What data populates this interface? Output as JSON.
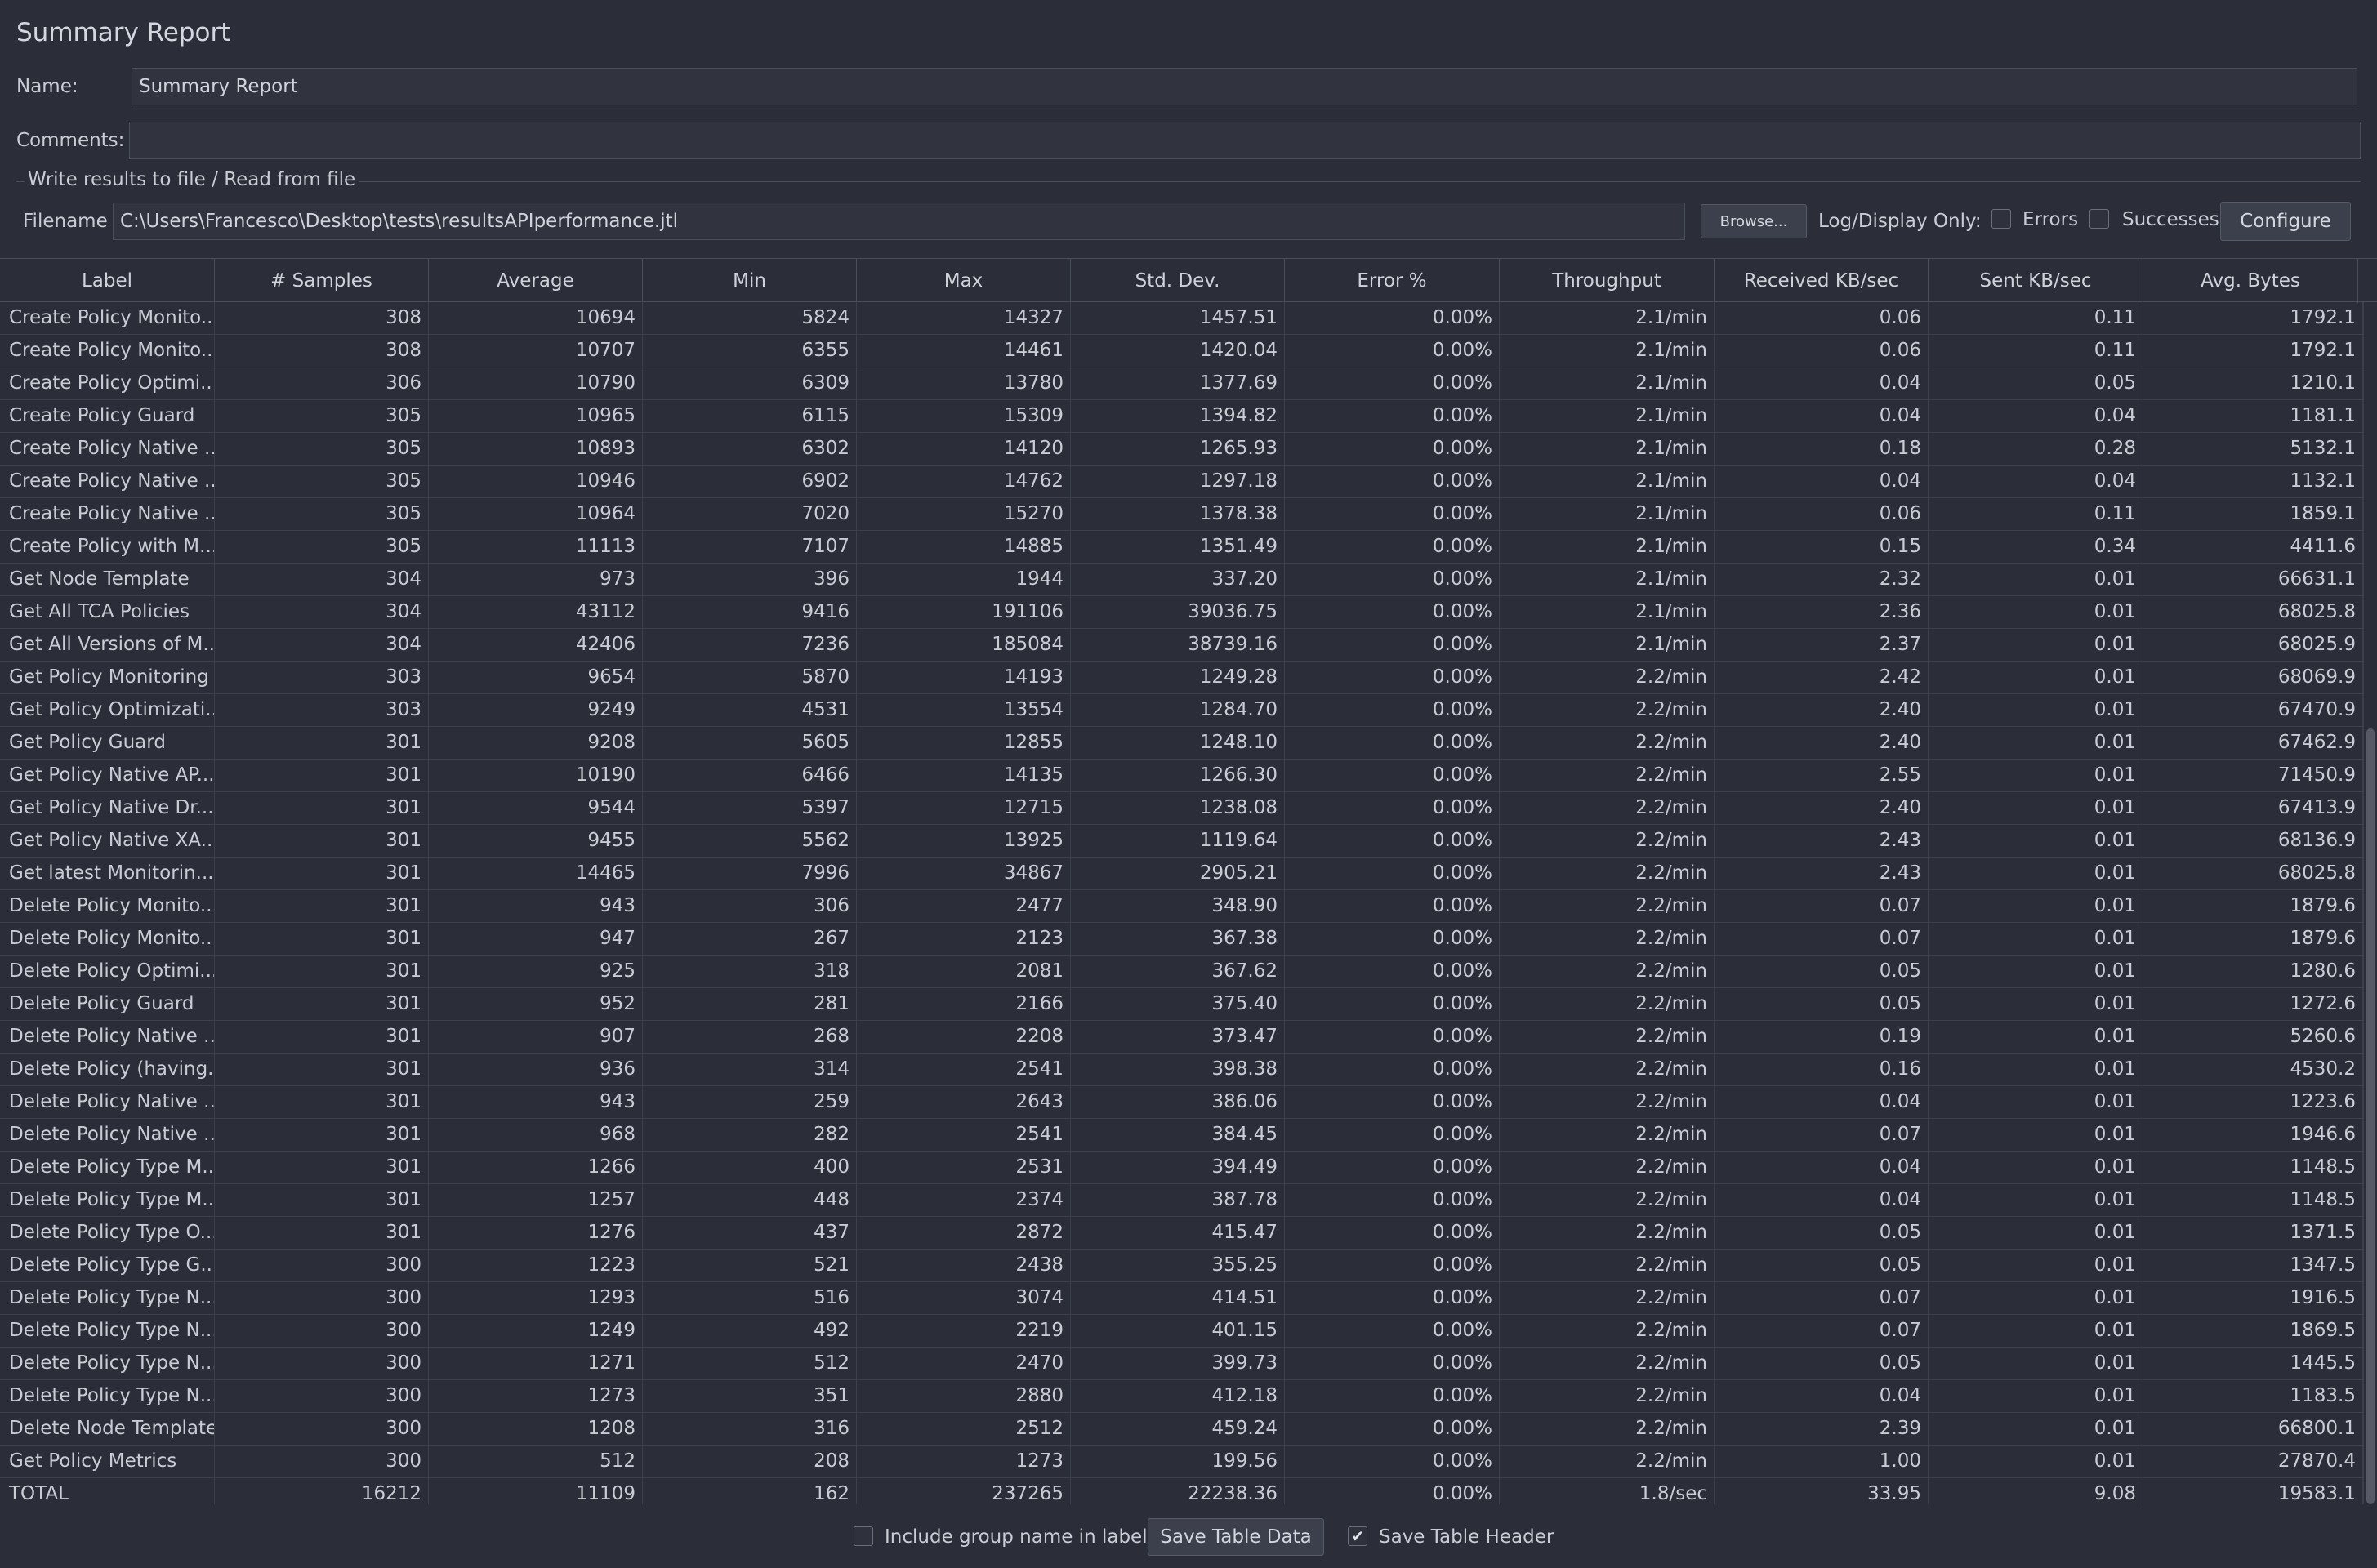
{
  "panel": {
    "title": "Summary Report"
  },
  "name": {
    "label": "Name:",
    "value": "Summary Report"
  },
  "comments": {
    "label": "Comments:",
    "value": ""
  },
  "file_group": {
    "title": "Write results to file / Read from file",
    "filename_label": "Filename",
    "filename_value": "C:\\Users\\Francesco\\Desktop\\tests\\resultsAPIperformance.jtl",
    "browse_label": "Browse...",
    "log_display_label": "Log/Display Only:",
    "errors_label": "Errors",
    "errors_checked": false,
    "successes_label": "Successes",
    "successes_checked": false,
    "configure_label": "Configure"
  },
  "table": {
    "columns": [
      "Label",
      "# Samples",
      "Average",
      "Min",
      "Max",
      "Std. Dev.",
      "Error %",
      "Throughput",
      "Received KB/sec",
      "Sent KB/sec",
      "Avg. Bytes"
    ],
    "rows": [
      [
        "Create Policy Monito...",
        "308",
        "10694",
        "5824",
        "14327",
        "1457.51",
        "0.00%",
        "2.1/min",
        "0.06",
        "0.11",
        "1792.1"
      ],
      [
        "Create Policy Monito...",
        "308",
        "10707",
        "6355",
        "14461",
        "1420.04",
        "0.00%",
        "2.1/min",
        "0.06",
        "0.11",
        "1792.1"
      ],
      [
        "Create Policy Optimi...",
        "306",
        "10790",
        "6309",
        "13780",
        "1377.69",
        "0.00%",
        "2.1/min",
        "0.04",
        "0.05",
        "1210.1"
      ],
      [
        "Create Policy Guard",
        "305",
        "10965",
        "6115",
        "15309",
        "1394.82",
        "0.00%",
        "2.1/min",
        "0.04",
        "0.04",
        "1181.1"
      ],
      [
        "Create Policy Native ...",
        "305",
        "10893",
        "6302",
        "14120",
        "1265.93",
        "0.00%",
        "2.1/min",
        "0.18",
        "0.28",
        "5132.1"
      ],
      [
        "Create Policy Native ...",
        "305",
        "10946",
        "6902",
        "14762",
        "1297.18",
        "0.00%",
        "2.1/min",
        "0.04",
        "0.04",
        "1132.1"
      ],
      [
        "Create Policy Native ...",
        "305",
        "10964",
        "7020",
        "15270",
        "1378.38",
        "0.00%",
        "2.1/min",
        "0.06",
        "0.11",
        "1859.1"
      ],
      [
        "Create Policy with M...",
        "305",
        "11113",
        "7107",
        "14885",
        "1351.49",
        "0.00%",
        "2.1/min",
        "0.15",
        "0.34",
        "4411.6"
      ],
      [
        "Get Node Template",
        "304",
        "973",
        "396",
        "1944",
        "337.20",
        "0.00%",
        "2.1/min",
        "2.32",
        "0.01",
        "66631.1"
      ],
      [
        "Get All TCA Policies",
        "304",
        "43112",
        "9416",
        "191106",
        "39036.75",
        "0.00%",
        "2.1/min",
        "2.36",
        "0.01",
        "68025.8"
      ],
      [
        "Get All Versions of M...",
        "304",
        "42406",
        "7236",
        "185084",
        "38739.16",
        "0.00%",
        "2.1/min",
        "2.37",
        "0.01",
        "68025.9"
      ],
      [
        "Get Policy Monitoring",
        "303",
        "9654",
        "5870",
        "14193",
        "1249.28",
        "0.00%",
        "2.2/min",
        "2.42",
        "0.01",
        "68069.9"
      ],
      [
        "Get Policy Optimizati...",
        "303",
        "9249",
        "4531",
        "13554",
        "1284.70",
        "0.00%",
        "2.2/min",
        "2.40",
        "0.01",
        "67470.9"
      ],
      [
        "Get Policy Guard",
        "301",
        "9208",
        "5605",
        "12855",
        "1248.10",
        "0.00%",
        "2.2/min",
        "2.40",
        "0.01",
        "67462.9"
      ],
      [
        "Get Policy Native AP...",
        "301",
        "10190",
        "6466",
        "14135",
        "1266.30",
        "0.00%",
        "2.2/min",
        "2.55",
        "0.01",
        "71450.9"
      ],
      [
        "Get Policy Native Dr...",
        "301",
        "9544",
        "5397",
        "12715",
        "1238.08",
        "0.00%",
        "2.2/min",
        "2.40",
        "0.01",
        "67413.9"
      ],
      [
        "Get Policy Native XA...",
        "301",
        "9455",
        "5562",
        "13925",
        "1119.64",
        "0.00%",
        "2.2/min",
        "2.43",
        "0.01",
        "68136.9"
      ],
      [
        "Get latest Monitorin...",
        "301",
        "14465",
        "7996",
        "34867",
        "2905.21",
        "0.00%",
        "2.2/min",
        "2.43",
        "0.01",
        "68025.8"
      ],
      [
        "Delete Policy Monito...",
        "301",
        "943",
        "306",
        "2477",
        "348.90",
        "0.00%",
        "2.2/min",
        "0.07",
        "0.01",
        "1879.6"
      ],
      [
        "Delete Policy Monito...",
        "301",
        "947",
        "267",
        "2123",
        "367.38",
        "0.00%",
        "2.2/min",
        "0.07",
        "0.01",
        "1879.6"
      ],
      [
        "Delete Policy Optimi...",
        "301",
        "925",
        "318",
        "2081",
        "367.62",
        "0.00%",
        "2.2/min",
        "0.05",
        "0.01",
        "1280.6"
      ],
      [
        "Delete Policy Guard",
        "301",
        "952",
        "281",
        "2166",
        "375.40",
        "0.00%",
        "2.2/min",
        "0.05",
        "0.01",
        "1272.6"
      ],
      [
        "Delete Policy Native ...",
        "301",
        "907",
        "268",
        "2208",
        "373.47",
        "0.00%",
        "2.2/min",
        "0.19",
        "0.01",
        "5260.6"
      ],
      [
        "Delete Policy (having...",
        "301",
        "936",
        "314",
        "2541",
        "398.38",
        "0.00%",
        "2.2/min",
        "0.16",
        "0.01",
        "4530.2"
      ],
      [
        "Delete Policy Native ...",
        "301",
        "943",
        "259",
        "2643",
        "386.06",
        "0.00%",
        "2.2/min",
        "0.04",
        "0.01",
        "1223.6"
      ],
      [
        "Delete Policy Native ...",
        "301",
        "968",
        "282",
        "2541",
        "384.45",
        "0.00%",
        "2.2/min",
        "0.07",
        "0.01",
        "1946.6"
      ],
      [
        "Delete Policy Type M...",
        "301",
        "1266",
        "400",
        "2531",
        "394.49",
        "0.00%",
        "2.2/min",
        "0.04",
        "0.01",
        "1148.5"
      ],
      [
        "Delete Policy Type M...",
        "301",
        "1257",
        "448",
        "2374",
        "387.78",
        "0.00%",
        "2.2/min",
        "0.04",
        "0.01",
        "1148.5"
      ],
      [
        "Delete Policy Type O...",
        "301",
        "1276",
        "437",
        "2872",
        "415.47",
        "0.00%",
        "2.2/min",
        "0.05",
        "0.01",
        "1371.5"
      ],
      [
        "Delete Policy Type G...",
        "300",
        "1223",
        "521",
        "2438",
        "355.25",
        "0.00%",
        "2.2/min",
        "0.05",
        "0.01",
        "1347.5"
      ],
      [
        "Delete Policy Type N...",
        "300",
        "1293",
        "516",
        "3074",
        "414.51",
        "0.00%",
        "2.2/min",
        "0.07",
        "0.01",
        "1916.5"
      ],
      [
        "Delete Policy Type N...",
        "300",
        "1249",
        "492",
        "2219",
        "401.15",
        "0.00%",
        "2.2/min",
        "0.07",
        "0.01",
        "1869.5"
      ],
      [
        "Delete Policy Type N...",
        "300",
        "1271",
        "512",
        "2470",
        "399.73",
        "0.00%",
        "2.2/min",
        "0.05",
        "0.01",
        "1445.5"
      ],
      [
        "Delete Policy Type N...",
        "300",
        "1273",
        "351",
        "2880",
        "412.18",
        "0.00%",
        "2.2/min",
        "0.04",
        "0.01",
        "1183.5"
      ],
      [
        "Delete Node Template",
        "300",
        "1208",
        "316",
        "2512",
        "459.24",
        "0.00%",
        "2.2/min",
        "2.39",
        "0.01",
        "66800.1"
      ],
      [
        "Get Policy Metrics",
        "300",
        "512",
        "208",
        "1273",
        "199.56",
        "0.00%",
        "2.2/min",
        "1.00",
        "0.01",
        "27870.4"
      ],
      [
        "TOTAL",
        "16212",
        "11109",
        "162",
        "237265",
        "22238.36",
        "0.00%",
        "1.8/sec",
        "33.95",
        "9.08",
        "19583.1"
      ]
    ]
  },
  "footer": {
    "include_group_label": "Include group name in label?",
    "include_group_checked": false,
    "save_table_data_label": "Save Table Data",
    "save_table_header_label": "Save Table Header",
    "save_table_header_checked": true
  }
}
